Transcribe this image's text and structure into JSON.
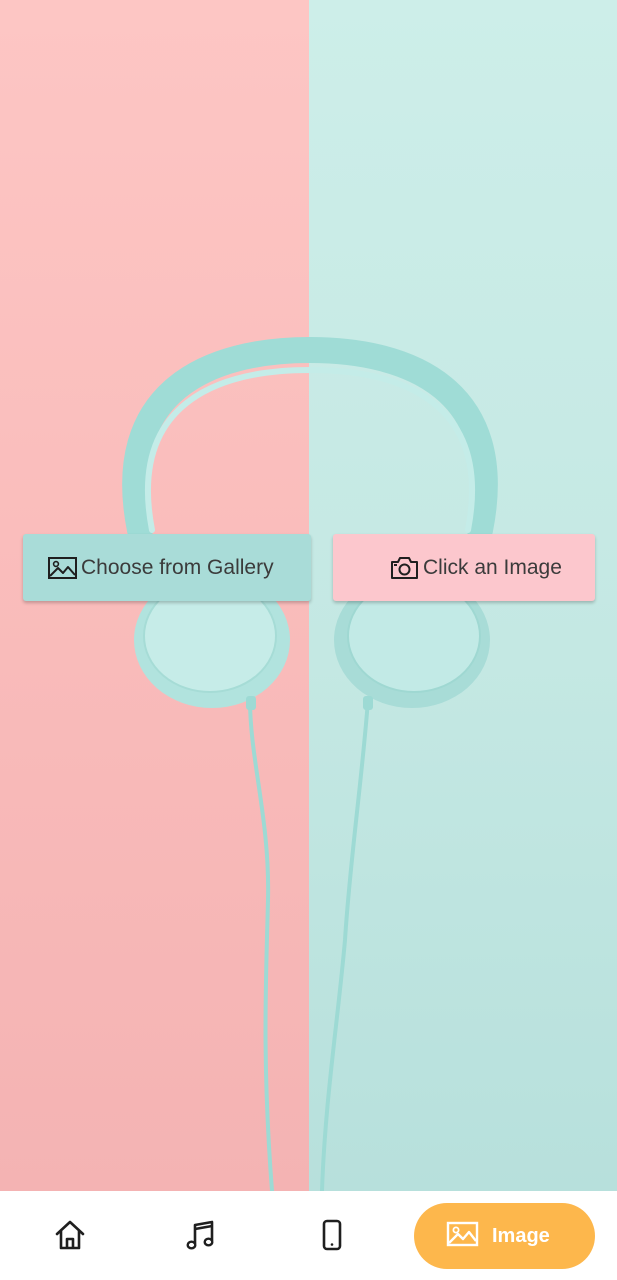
{
  "actions": {
    "gallery_label": "Choose from Gallery",
    "gallery_icon": "image-icon",
    "camera_label": "Click an Image",
    "camera_icon": "camera-icon"
  },
  "bottom_nav": {
    "items": [
      {
        "icon": "home-icon",
        "label": ""
      },
      {
        "icon": "music-note-icon",
        "label": ""
      },
      {
        "icon": "phone-icon",
        "label": ""
      },
      {
        "icon": "image-icon",
        "label": "Image",
        "active": true
      }
    ],
    "active_label": "Image"
  },
  "colors": {
    "background_left": "#f9bbba",
    "background_right": "#c4e8e3",
    "gallery_button": "#a9dcd8",
    "camera_button": "#fcc7cd",
    "nav_active": "#fdb74c",
    "nav_icon": "#1f1f1f"
  }
}
